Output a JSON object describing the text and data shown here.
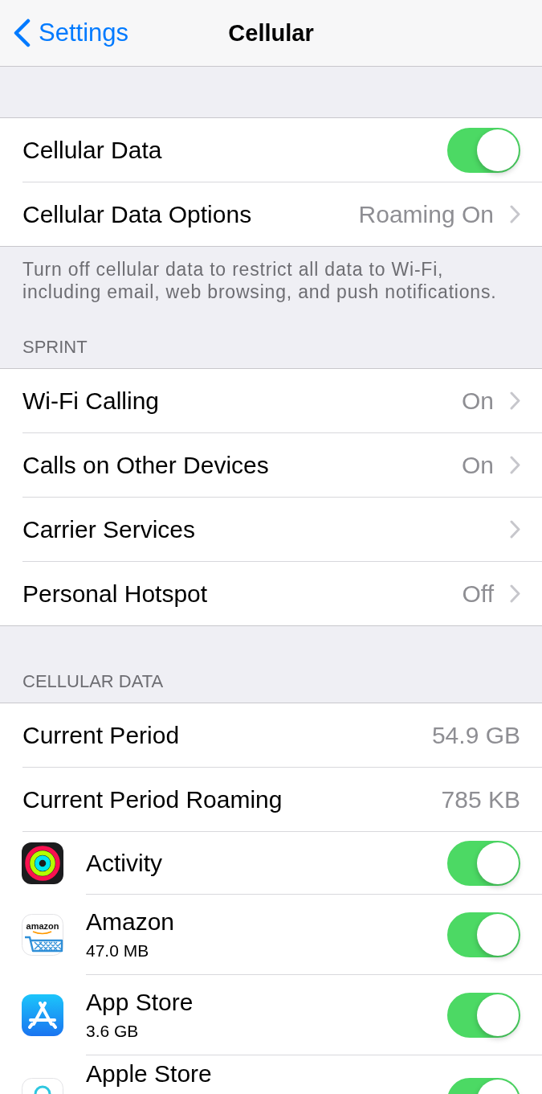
{
  "nav": {
    "back_label": "Settings",
    "title": "Cellular"
  },
  "sections": [
    {
      "rows": [
        {
          "kind": "toggle",
          "label": "Cellular Data",
          "on": true
        },
        {
          "kind": "link",
          "label": "Cellular Data Options",
          "value": "Roaming On"
        }
      ],
      "footer": "Turn off cellular data to restrict all data to Wi-Fi, including email, web browsing, and push notifications."
    },
    {
      "header": "SPRINT",
      "rows": [
        {
          "kind": "link",
          "label": "Wi-Fi Calling",
          "value": "On"
        },
        {
          "kind": "link",
          "label": "Calls on Other Devices",
          "value": "On"
        },
        {
          "kind": "link",
          "label": "Carrier Services"
        },
        {
          "kind": "link",
          "label": "Personal Hotspot",
          "value": "Off"
        }
      ]
    },
    {
      "header": "CELLULAR DATA",
      "rows": [
        {
          "kind": "value",
          "label": "Current Period",
          "value": "54.9 GB"
        },
        {
          "kind": "value",
          "label": "Current Period Roaming",
          "value": "785 KB"
        }
      ],
      "apps": [
        {
          "name": "Activity",
          "on": true
        },
        {
          "name": "Amazon",
          "usage": "47.0 MB",
          "icon_text": "amazon",
          "on": true
        },
        {
          "name": "App Store",
          "usage": "3.6 GB",
          "on": true
        },
        {
          "name": "Apple Store",
          "on": true
        }
      ]
    }
  ]
}
